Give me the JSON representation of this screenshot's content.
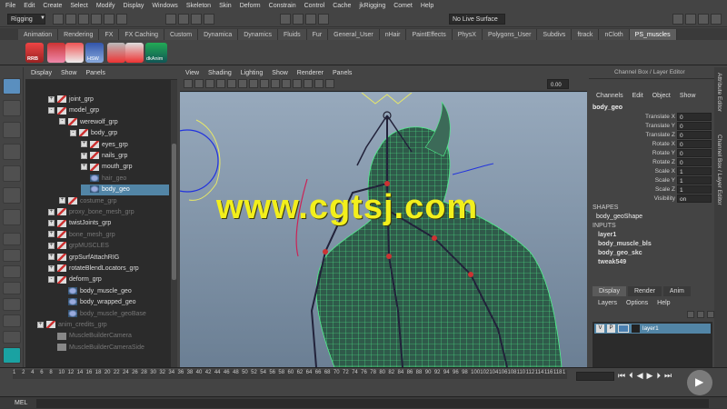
{
  "menubar": [
    "File",
    "Edit",
    "Create",
    "Select",
    "Modify",
    "Display",
    "Windows",
    "Skeleton",
    "Skin",
    "Deform",
    "Constrain",
    "Control",
    "Cache",
    "jkRigging",
    "Comet",
    "Help"
  ],
  "status": {
    "mode": "Rigging",
    "live_surface": "No Live Surface"
  },
  "shelf_tabs": [
    "Animation",
    "Rendering",
    "FX",
    "FX Caching",
    "Custom",
    "Dynamica",
    "Dynamics",
    "Fluids",
    "Fur",
    "General_User",
    "nHair",
    "PaintEffects",
    "PhysX",
    "Polygons_User",
    "Subdivs",
    "ftrack",
    "nCloth",
    "PS_muscles"
  ],
  "shelf_labels": {
    "rrb": "RRB",
    "hsw": "HSW",
    "dkanim": "dkAnim"
  },
  "outliner": {
    "menu": [
      "Display",
      "Show",
      "Panels"
    ],
    "rows": [
      {
        "label": "joint_grp",
        "indent": 0,
        "pm": "+",
        "icon": "group",
        "dim": false,
        "sel": false
      },
      {
        "label": "model_grp",
        "indent": 0,
        "pm": "-",
        "icon": "group",
        "dim": false,
        "sel": false
      },
      {
        "label": "werewolf_grp",
        "indent": 1,
        "pm": "-",
        "icon": "group",
        "dim": false,
        "sel": false
      },
      {
        "label": "body_grp",
        "indent": 2,
        "pm": "-",
        "icon": "group",
        "dim": false,
        "sel": false
      },
      {
        "label": "eyes_grp",
        "indent": 3,
        "pm": "+",
        "icon": "group",
        "dim": false,
        "sel": false
      },
      {
        "label": "nails_grp",
        "indent": 3,
        "pm": "+",
        "icon": "group",
        "dim": false,
        "sel": false
      },
      {
        "label": "mouth_grp",
        "indent": 3,
        "pm": "+",
        "icon": "group",
        "dim": false,
        "sel": false
      },
      {
        "label": "hair_geo",
        "indent": 3,
        "pm": "",
        "icon": "mesh",
        "dim": true,
        "sel": false
      },
      {
        "label": "body_geo",
        "indent": 3,
        "pm": "",
        "icon": "mesh",
        "dim": false,
        "sel": true
      },
      {
        "label": "costume_grp",
        "indent": 1,
        "pm": "+",
        "icon": "group",
        "dim": true,
        "sel": false
      },
      {
        "label": "proxy_bone_mesh_grp",
        "indent": 0,
        "pm": "+",
        "icon": "group",
        "dim": true,
        "sel": false
      },
      {
        "label": "twistJoints_grp",
        "indent": 0,
        "pm": "+",
        "icon": "group",
        "dim": false,
        "sel": false
      },
      {
        "label": "bone_mesh_grp",
        "indent": 0,
        "pm": "+",
        "icon": "group",
        "dim": true,
        "sel": false
      },
      {
        "label": "grpMUSCLES",
        "indent": 0,
        "pm": "+",
        "icon": "group",
        "dim": true,
        "sel": false
      },
      {
        "label": "grpSurfAttachRIG",
        "indent": 0,
        "pm": "+",
        "icon": "group",
        "dim": false,
        "sel": false
      },
      {
        "label": "rotateBlendLocators_grp",
        "indent": 0,
        "pm": "+",
        "icon": "group",
        "dim": false,
        "sel": false
      },
      {
        "label": "deform_grp",
        "indent": 0,
        "pm": "-",
        "icon": "group",
        "dim": false,
        "sel": false
      },
      {
        "label": "body_muscle_geo",
        "indent": 1,
        "pm": "",
        "icon": "mesh",
        "dim": false,
        "sel": false
      },
      {
        "label": "body_wrapped_geo",
        "indent": 1,
        "pm": "",
        "icon": "mesh",
        "dim": false,
        "sel": false
      },
      {
        "label": "body_muscle_geoBase",
        "indent": 1,
        "pm": "",
        "icon": "mesh",
        "dim": true,
        "sel": false
      },
      {
        "label": "anim_credits_grp",
        "indent": -1,
        "pm": "+",
        "icon": "group",
        "dim": true,
        "sel": false
      },
      {
        "label": "MuscleBuilderCamera",
        "indent": 0,
        "pm": "",
        "icon": "camera",
        "dim": true,
        "sel": false
      },
      {
        "label": "MuscleBuilderCameraSide",
        "indent": 0,
        "pm": "",
        "icon": "camera",
        "dim": true,
        "sel": false
      }
    ]
  },
  "viewport": {
    "menu": [
      "View",
      "Shading",
      "Lighting",
      "Show",
      "Renderer",
      "Panels"
    ],
    "field_value": "0.00",
    "watermark": "www.cgtsj.com"
  },
  "channel_box": {
    "title": "Channel Box / Layer Editor",
    "menu": [
      "Channels",
      "Edit",
      "Object",
      "Show"
    ],
    "object": "body_geo",
    "attrs": [
      {
        "label": "Translate X",
        "value": "0"
      },
      {
        "label": "Translate Y",
        "value": "0"
      },
      {
        "label": "Translate Z",
        "value": "0"
      },
      {
        "label": "Rotate X",
        "value": "0"
      },
      {
        "label": "Rotate Y",
        "value": "0"
      },
      {
        "label": "Rotate Z",
        "value": "0"
      },
      {
        "label": "Scale X",
        "value": "1"
      },
      {
        "label": "Scale Y",
        "value": "1"
      },
      {
        "label": "Scale Z",
        "value": "1"
      },
      {
        "label": "Visibility",
        "value": "on"
      }
    ],
    "shapes_header": "SHAPES",
    "shape": "body_geoShape",
    "inputs_header": "INPUTS",
    "inputs": [
      "layer1",
      "body_muscle_bls",
      "body_geo_skc",
      "tweak549"
    ]
  },
  "layer_editor": {
    "tabs": [
      "Display",
      "Render",
      "Anim"
    ],
    "menu": [
      "Layers",
      "Options",
      "Help"
    ],
    "layer": {
      "v": "V",
      "p": "P",
      "name": "layer1"
    }
  },
  "side_tabs": [
    "Attribute Editor",
    "Channel Box / Layer Editor"
  ],
  "timeline": {
    "ticks": [
      "1",
      "2",
      "4",
      "6",
      "8",
      "10",
      "12",
      "14",
      "16",
      "18",
      "20",
      "22",
      "24",
      "26",
      "28",
      "30",
      "32",
      "34",
      "36",
      "38",
      "40",
      "42",
      "44",
      "46",
      "48",
      "50",
      "52",
      "54",
      "56",
      "58",
      "60",
      "62",
      "64",
      "66",
      "68",
      "70",
      "72",
      "74",
      "76",
      "78",
      "80",
      "82",
      "84",
      "86",
      "88",
      "90",
      "92",
      "94",
      "96",
      "98",
      "100",
      "102",
      "104",
      "106",
      "108",
      "110",
      "112",
      "114",
      "116",
      "118",
      "1"
    ]
  },
  "command_line": {
    "label": "MEL"
  },
  "colors": {
    "selection": "#5285a6",
    "wire": "#3fe07a",
    "watermark": "#f2ef1c"
  }
}
